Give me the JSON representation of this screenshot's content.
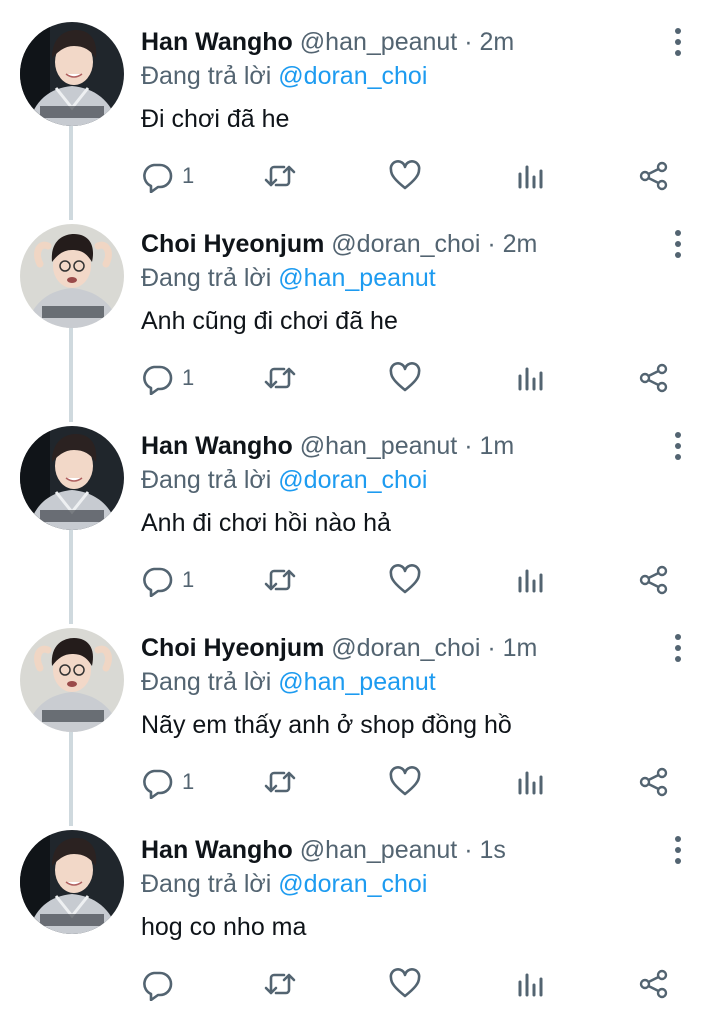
{
  "colors": {
    "text": "#0f1419",
    "muted": "#536471",
    "mention": "#1d9bf0",
    "thread_line": "#cfd9de"
  },
  "icons": {
    "reply": "reply-icon",
    "retweet": "retweet-icon",
    "like": "heart-icon",
    "stats": "analytics-icon",
    "share": "share-icon",
    "more": "more-vertical-icon"
  },
  "tweets": [
    {
      "name": "Han Wangho",
      "handle": "@han_peanut",
      "separator": "·",
      "time": "2m",
      "replying_prefix": "Đang trả lời",
      "replying_to": "@doran_choi",
      "text": "Đi chơi đã he",
      "reply_count": "1",
      "avatar": "avatar-han"
    },
    {
      "name": "Choi Hyeonjum",
      "handle": "@doran_choi",
      "separator": "·",
      "time": "2m",
      "replying_prefix": "Đang trả lời",
      "replying_to": "@han_peanut",
      "text": "Anh cũng đi chơi đã he",
      "reply_count": "1",
      "avatar": "avatar-choi"
    },
    {
      "name": "Han Wangho",
      "handle": "@han_peanut",
      "separator": "·",
      "time": "1m",
      "replying_prefix": "Đang trả lời",
      "replying_to": "@doran_choi",
      "text": "Anh đi chơi hồi nào hả",
      "reply_count": "1",
      "avatar": "avatar-han"
    },
    {
      "name": "Choi Hyeonjum",
      "handle": "@doran_choi",
      "separator": "·",
      "time": "1m",
      "replying_prefix": "Đang trả lời",
      "replying_to": "@han_peanut",
      "text": "Nãy em thấy anh ở shop đồng hồ",
      "reply_count": "1",
      "avatar": "avatar-choi"
    },
    {
      "name": "Han Wangho",
      "handle": "@han_peanut",
      "separator": "·",
      "time": "1s",
      "replying_prefix": "Đang trả lời",
      "replying_to": "@doran_choi",
      "text": "hog co nho ma",
      "reply_count": "",
      "avatar": "avatar-han"
    }
  ]
}
